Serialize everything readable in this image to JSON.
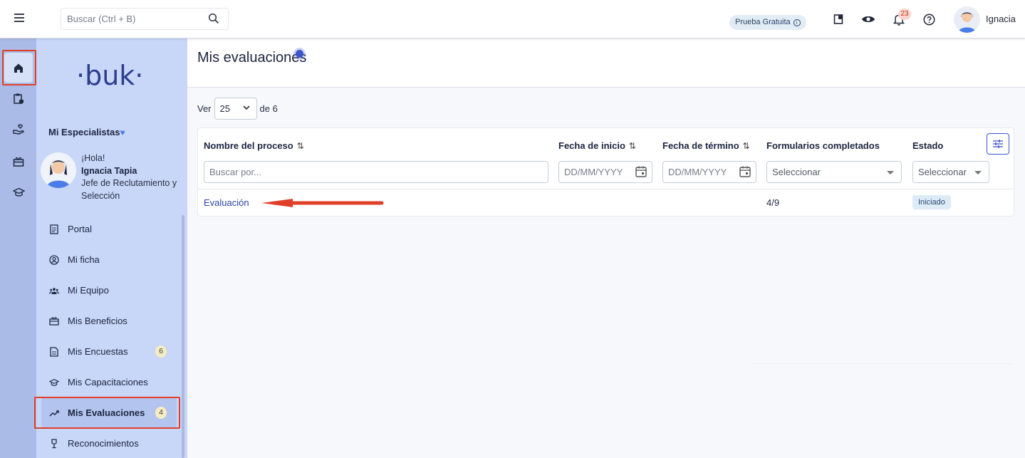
{
  "topbar": {
    "search_placeholder": "Buscar (Ctrl + B)",
    "trial_label": "Prueba Gratuita",
    "notifications_count": "23",
    "user_name": "Ignacia"
  },
  "sidebar": {
    "logo_text": "·buk·",
    "group_title": "Mi Especialistas",
    "profile": {
      "greeting": "¡Hola!",
      "name": "Ignacia Tapia",
      "role": "Jefe de Reclutamiento y Selección"
    },
    "menu": [
      {
        "label": "Portal",
        "icon": "document-icon"
      },
      {
        "label": "Mi ficha",
        "icon": "user-circle-icon"
      },
      {
        "label": "Mi Equipo",
        "icon": "team-icon"
      },
      {
        "label": "Mis Beneficios",
        "icon": "gift-icon"
      },
      {
        "label": "Mis Encuestas",
        "icon": "survey-icon",
        "count": "6"
      },
      {
        "label": "Mis Capacitaciones",
        "icon": "graduation-cap-icon"
      },
      {
        "label": "Mis Evaluaciones",
        "icon": "trending-up-icon",
        "count": "4",
        "active": true
      },
      {
        "label": "Reconocimientos",
        "icon": "trophy-icon"
      }
    ]
  },
  "main": {
    "title": "Mis evaluaciones",
    "pager": {
      "prefix": "Ver",
      "page_size": "25",
      "suffix": "de 6"
    },
    "table": {
      "columns": {
        "name": "Nombre del proceso",
        "start": "Fecha de inicio",
        "end": "Fecha de término",
        "forms": "Formularios completados",
        "status": "Estado"
      },
      "filters": {
        "name_placeholder": "Buscar por...",
        "start_placeholder": "DD/MM/YYYY",
        "end_placeholder": "DD/MM/YYYY",
        "forms_select": "Seleccionar",
        "status_select": "Seleccionar"
      },
      "rows": [
        {
          "name": "Evaluación",
          "start": "",
          "end": "",
          "forms": "4/9",
          "status": "Iniciado"
        }
      ]
    }
  },
  "colors": {
    "rail": "#a9bbe6",
    "sidebar": "#c8d6f7",
    "accent": "#2f46a8",
    "annotation_red": "#e0402a"
  }
}
